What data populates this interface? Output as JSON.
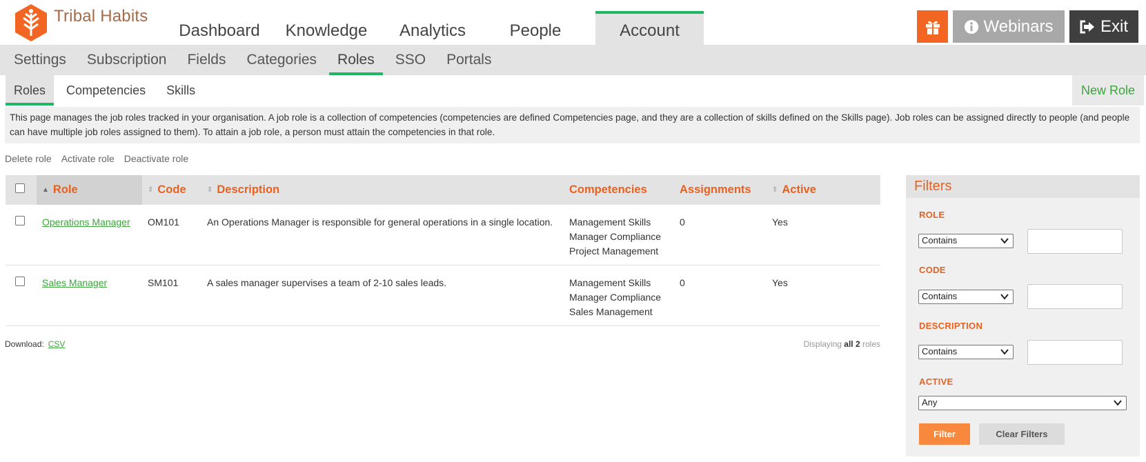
{
  "brand": {
    "name": "Tribal Habits",
    "accent": "#f26522",
    "green": "#1eb864"
  },
  "main_nav": [
    {
      "label": "Dashboard",
      "active": false
    },
    {
      "label": "Knowledge",
      "active": false
    },
    {
      "label": "Analytics",
      "active": false
    },
    {
      "label": "People",
      "active": false
    },
    {
      "label": "Account",
      "active": true
    }
  ],
  "top_buttons": {
    "gift_icon": "gift-icon",
    "webinars": "Webinars",
    "exit": "Exit"
  },
  "sub_nav": [
    {
      "label": "Settings"
    },
    {
      "label": "Subscription"
    },
    {
      "label": "Fields"
    },
    {
      "label": "Categories"
    },
    {
      "label": "Roles",
      "active": true
    },
    {
      "label": "SSO"
    },
    {
      "label": "Portals"
    }
  ],
  "tabs": [
    {
      "label": "Roles",
      "active": true
    },
    {
      "label": "Competencies"
    },
    {
      "label": "Skills"
    }
  ],
  "new_role_label": "New Role",
  "info_text": "This page manages the job roles tracked in your organisation. A job role is a collection of competencies (competencies are defined Competencies page, and they are a collection of skills defined on the Skills page). Job roles can be assigned directly to people (and people can have multiple job roles assigned to them). To attain a job role, a person must attain the competencies in that role.",
  "bulk_actions": [
    "Delete role",
    "Activate role",
    "Deactivate role"
  ],
  "table": {
    "columns": [
      "Role",
      "Code",
      "Description",
      "Competencies",
      "Assignments",
      "Active"
    ],
    "rows": [
      {
        "role": "Operations Manager",
        "code": "OM101",
        "description": "An Operations Manager is responsible for general operations in a single location.",
        "competencies": [
          "Management Skills",
          "Manager Compliance",
          "Project Management"
        ],
        "assignments": "0",
        "active": "Yes"
      },
      {
        "role": "Sales Manager",
        "code": "SM101",
        "description": "A sales manager supervises a team of 2-10 sales leads.",
        "competencies": [
          "Management Skills",
          "Manager Compliance",
          "Sales Management"
        ],
        "assignments": "0",
        "active": "Yes"
      }
    ]
  },
  "download": {
    "label": "Download:",
    "link": "CSV"
  },
  "displaying": {
    "prefix": "Displaying",
    "bold": "all 2",
    "suffix": "roles"
  },
  "filters": {
    "title": "Filters",
    "role_label": "ROLE",
    "code_label": "CODE",
    "description_label": "DESCRIPTION",
    "active_label": "ACTIVE",
    "contains": "Contains",
    "any": "Any",
    "filter_button": "Filter",
    "clear_button": "Clear Filters"
  }
}
